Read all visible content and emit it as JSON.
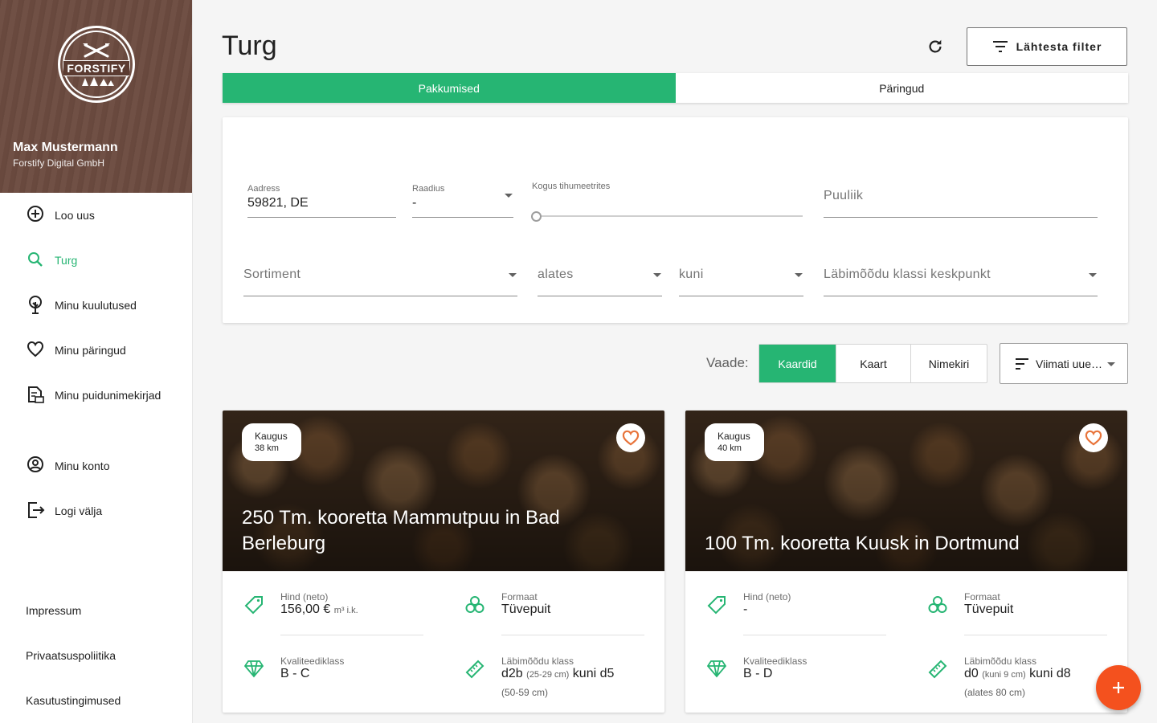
{
  "sidebar": {
    "logo_text": "FORSTIFY",
    "user_name": "Max Mustermann",
    "user_org": "Forstify Digital GmbH",
    "items": [
      {
        "label": "Loo uus",
        "icon": "add-circle-icon"
      },
      {
        "label": "Turg",
        "icon": "search-icon"
      },
      {
        "label": "Minu kuulutused",
        "icon": "tree-icon"
      },
      {
        "label": "Minu päringud",
        "icon": "heart-icon"
      },
      {
        "label": "Minu puidunimekirjad",
        "icon": "document-list-icon"
      },
      {
        "label": "Minu konto",
        "icon": "account-circle-icon"
      },
      {
        "label": "Logi välja",
        "icon": "logout-icon"
      }
    ],
    "footer": [
      "Impressum",
      "Privaatsuspoliitika",
      "Kasutustingimused"
    ]
  },
  "header": {
    "title": "Turg",
    "reset_label": "Lähtesta filter"
  },
  "tabs": [
    "Pakkumised",
    "Päringud"
  ],
  "filters": {
    "address_label": "Aadress",
    "address_value": "59821, DE",
    "radius_label": "Raadius",
    "radius_value": "-",
    "quantity_label": "Kogus tihumeetrites",
    "quantity_value": 0,
    "species_placeholder": "Puuliik",
    "assortment_placeholder": "Sortiment",
    "from_placeholder": "alates",
    "to_placeholder": "kuni",
    "diameter_placeholder": "Läbimõõdu klassi keskpunkt"
  },
  "view": {
    "label": "Vaade:",
    "options": [
      "Kaardid",
      "Kaart",
      "Nimekiri"
    ],
    "active": 0,
    "sort_label": "Viimati uuendatud"
  },
  "listings": [
    {
      "distance_label": "Kaugus",
      "distance": "38 km",
      "title": "250 Tm. kooretta Mammutpuu in Bad Berleburg",
      "price_label": "Hind (neto)",
      "price": "156,00 €",
      "price_unit": "m³ i.k.",
      "format_label": "Formaat",
      "format": "Tüvepuit",
      "quality_label": "Kvaliteediklass",
      "quality": "B - C",
      "diameter_label": "Läbimõõdu klass",
      "diameter_main": "d2b",
      "diameter_small": "(25-29 cm)",
      "diameter_to": "kuni d5",
      "diameter_sub": "(50-59 cm)"
    },
    {
      "distance_label": "Kaugus",
      "distance": "40 km",
      "title": "100 Tm. kooretta Kuusk in Dortmund",
      "price_label": "Hind (neto)",
      "price": "-",
      "price_unit": "",
      "format_label": "Formaat",
      "format": "Tüvepuit",
      "quality_label": "Kvaliteediklass",
      "quality": "B - D",
      "diameter_label": "Läbimõõdu klass",
      "diameter_main": "d0",
      "diameter_small": "(kuni 9 cm)",
      "diameter_to": "kuni d8",
      "diameter_sub": "(alates 80 cm)"
    }
  ],
  "colors": {
    "accent": "#26b573",
    "fab": "#f4511e",
    "sidebar_header": "#6d4c41",
    "favorite": "#e8743b"
  }
}
